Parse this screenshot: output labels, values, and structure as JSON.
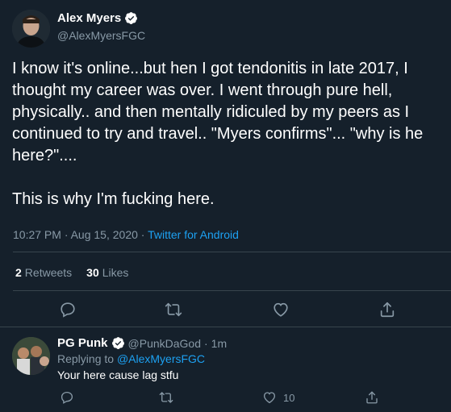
{
  "colors": {
    "background": "#15202b",
    "text_primary": "#ffffff",
    "text_secondary": "#8899a6",
    "link": "#1da1f2",
    "border": "#38444d"
  },
  "tweet": {
    "author_name": "Alex Myers",
    "author_handle": "@AlexMyersFGC",
    "verified_icon": "verified-badge-icon",
    "text": "I know it's online...but hen I got tendonitis in late 2017, I thought my career was over. I went through pure hell, physically.. and then mentally ridiculed by my peers as I continued to try and travel.. \"Myers confirms\"... \"why is he here?\"....\n\nThis is why I'm fucking here.",
    "timestamp": "10:27 PM · Aug 15, 2020 ·",
    "source": "Twitter for Android",
    "retweets_count": "2",
    "retweets_label": "Retweets",
    "likes_count": "30",
    "likes_label": "Likes",
    "action_icons": [
      "reply-icon",
      "retweet-icon",
      "like-icon",
      "share-icon"
    ]
  },
  "reply": {
    "author_name": "PG Punk",
    "author_handle": "@PunkDaGod",
    "separator": "·",
    "time": "1m",
    "replying_to_label": "Replying to",
    "replying_to_handle": "@AlexMyersFGC",
    "text": "Your here cause lag stfu",
    "like_count": "10",
    "action_icons": [
      "reply-icon",
      "retweet-icon",
      "like-icon",
      "share-icon"
    ]
  }
}
